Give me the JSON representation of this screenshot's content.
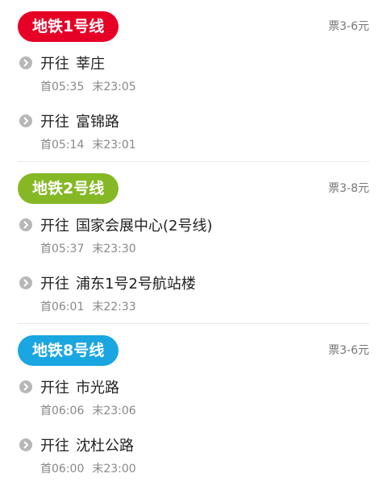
{
  "lines": [
    {
      "name": "地铁1号线",
      "color": "#e60026",
      "fare": "票3-6元",
      "directions": [
        {
          "prefix": "开往",
          "destination": "莘庄",
          "first": "首05:35",
          "last": "末23:05"
        },
        {
          "prefix": "开往",
          "destination": "富锦路",
          "first": "首05:14",
          "last": "末23:01"
        }
      ]
    },
    {
      "name": "地铁2号线",
      "color": "#86b825",
      "fare": "票3-8元",
      "directions": [
        {
          "prefix": "开往",
          "destination": "国家会展中心(2号线)",
          "first": "首05:37",
          "last": "末23:30"
        },
        {
          "prefix": "开往",
          "destination": "浦东1号2号航站楼",
          "first": "首06:01",
          "last": "末22:33"
        }
      ]
    },
    {
      "name": "地铁8号线",
      "color": "#1aa6e0",
      "fare": "票3-6元",
      "directions": [
        {
          "prefix": "开往",
          "destination": "市光路",
          "first": "首06:06",
          "last": "末23:06"
        },
        {
          "prefix": "开往",
          "destination": "沈杜公路",
          "first": "首06:00",
          "last": "末23:00"
        }
      ]
    }
  ],
  "icons": {
    "direction": "chevron-right-circle-icon"
  }
}
